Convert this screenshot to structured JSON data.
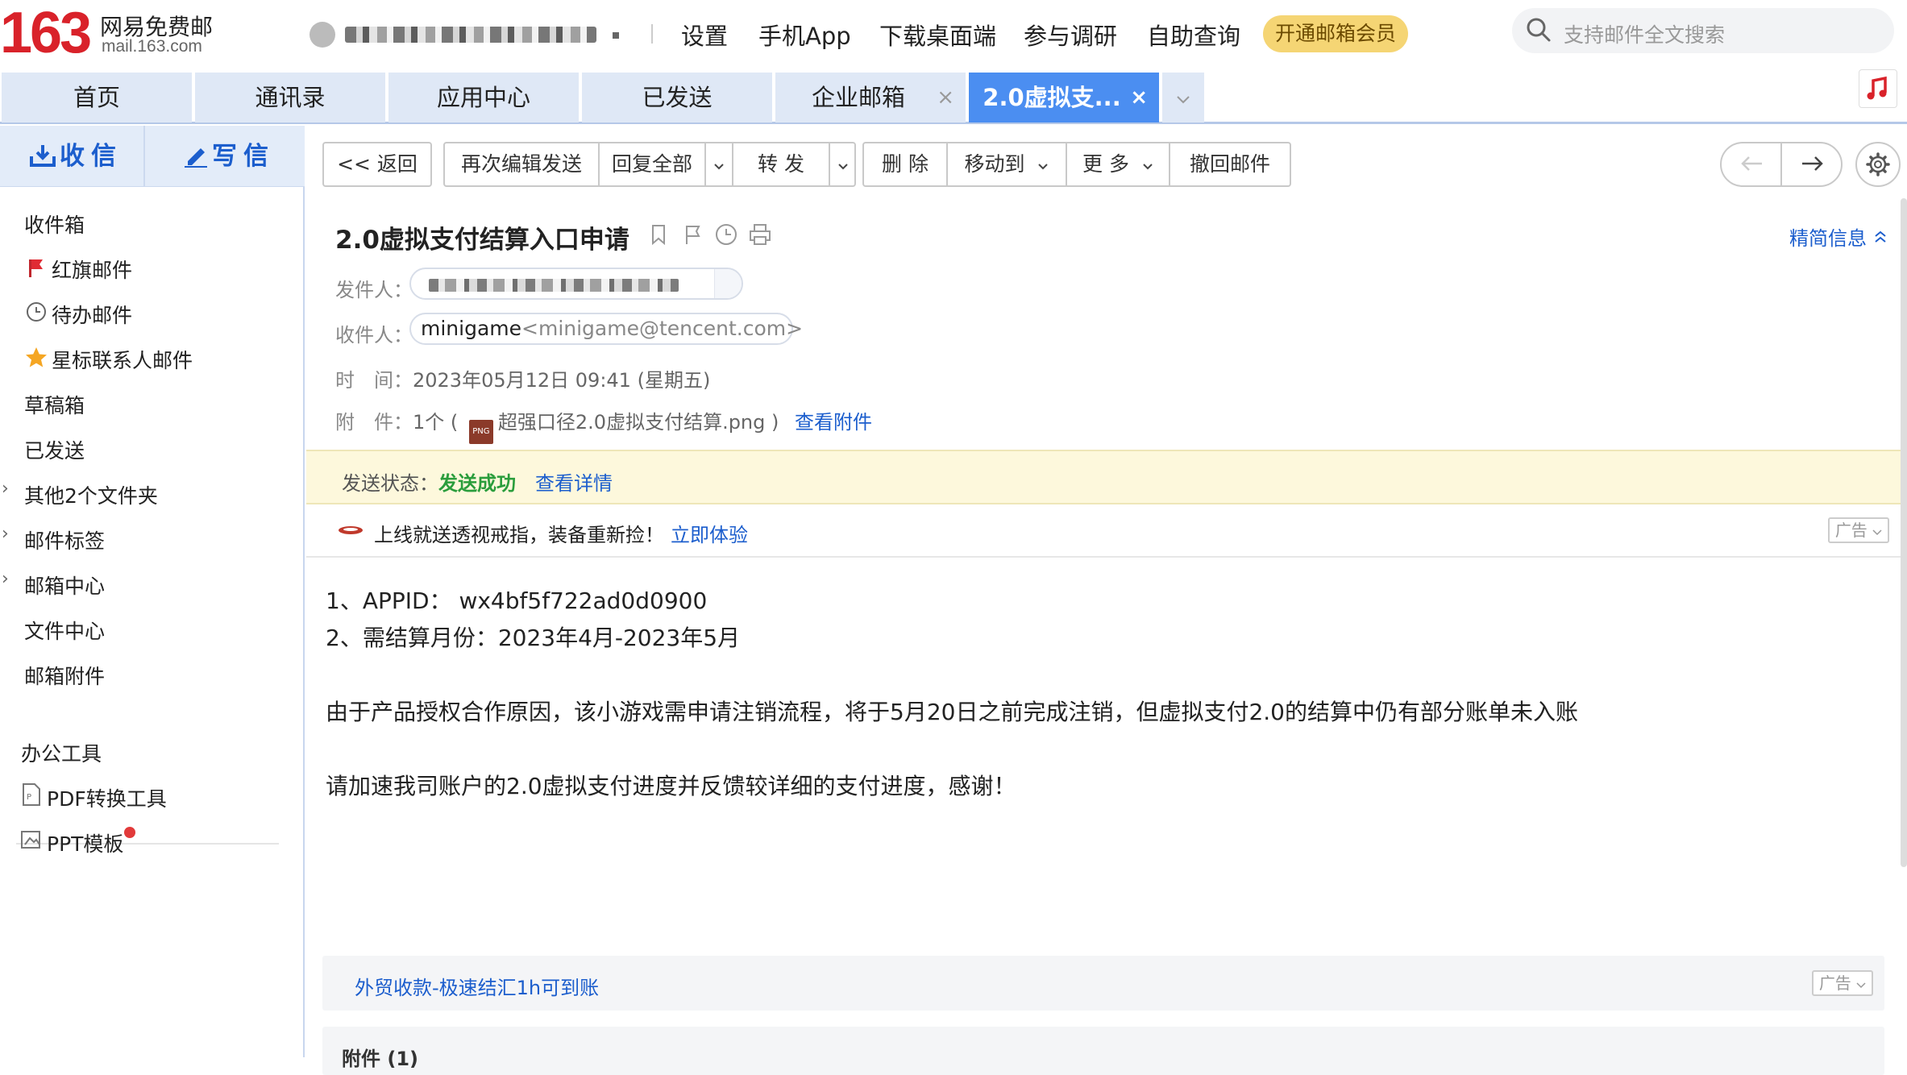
{
  "header": {
    "logo_number": "163",
    "logo_title": "网易免费邮",
    "logo_domain": "mail.163.com",
    "links": [
      "设置",
      "手机App",
      "下载桌面端",
      "参与调研",
      "自助查询"
    ],
    "vip_button": "开通邮箱会员",
    "search_placeholder": "支持邮件全文搜索"
  },
  "tabs": [
    {
      "label": "首页"
    },
    {
      "label": "通讯录"
    },
    {
      "label": "应用中心"
    },
    {
      "label": "已发送"
    },
    {
      "label": "企业邮箱",
      "close": "×"
    },
    {
      "label": "2.0虚拟支...",
      "close": "×"
    }
  ],
  "sidebar": {
    "receive": "收信",
    "compose": "写信",
    "items": [
      "收件箱",
      "红旗邮件",
      "待办邮件",
      "星标联系人邮件",
      "草稿箱",
      "已发送",
      "其他2个文件夹",
      "邮件标签",
      "邮箱中心",
      "文件中心",
      "邮箱附件"
    ],
    "tools_title": "办公工具",
    "tools": [
      "PDF转换工具",
      "PPT模板"
    ]
  },
  "toolbar": {
    "back": "<< 返回",
    "reedit": "再次编辑发送",
    "reply_all": "回复全部",
    "forward": "转 发",
    "delete": "删 除",
    "move": "移动到",
    "more": "更 多",
    "recall": "撤回邮件"
  },
  "mail": {
    "subject": "2.0虚拟支付结算入口申请",
    "brief_info": "精简信息",
    "from_label": "发件人：",
    "to_label": "收件人：",
    "to_name": "minigame",
    "to_email": "<minigame@tencent.com>",
    "time_label": "时　间：",
    "time_value": "2023年05月12日 09:41 (星期五)",
    "attach_label": "附　件：",
    "attach_count": "1个 (",
    "attach_file": "超强口径2.0虚拟支付结算.png",
    "attach_close": ")",
    "view_attach": "查看附件",
    "status_label": "发送状态：",
    "status_value": "发送成功",
    "status_detail": "查看详情",
    "ad_text": "上线就送透视戒指，装备重新捡！",
    "ad_link": "立即体验",
    "ad_tag": "广告",
    "body": [
      "1、APPID： wx4bf5f722ad0d0900",
      "2、需结算月份：2023年4月-2023年5月",
      "由于产品授权合作原因，该小游戏需申请注销流程，将于5月20日之前完成注销，但虚拟支付2.0的结算中仍有部分账单未入账",
      "请加速我司账户的2.0虚拟支付进度并反馈较详细的支付进度，感谢！"
    ],
    "bottom_ad": "外贸收款-极速结汇1h可到账",
    "bottom_ad_tag": "广告",
    "attach_section": "附件 (1)"
  },
  "colors": {
    "brand_red": "#d9222a",
    "link_blue": "#1c5ecd",
    "tab_active": "#4b8ef1",
    "success_green": "#2a9d3c"
  }
}
